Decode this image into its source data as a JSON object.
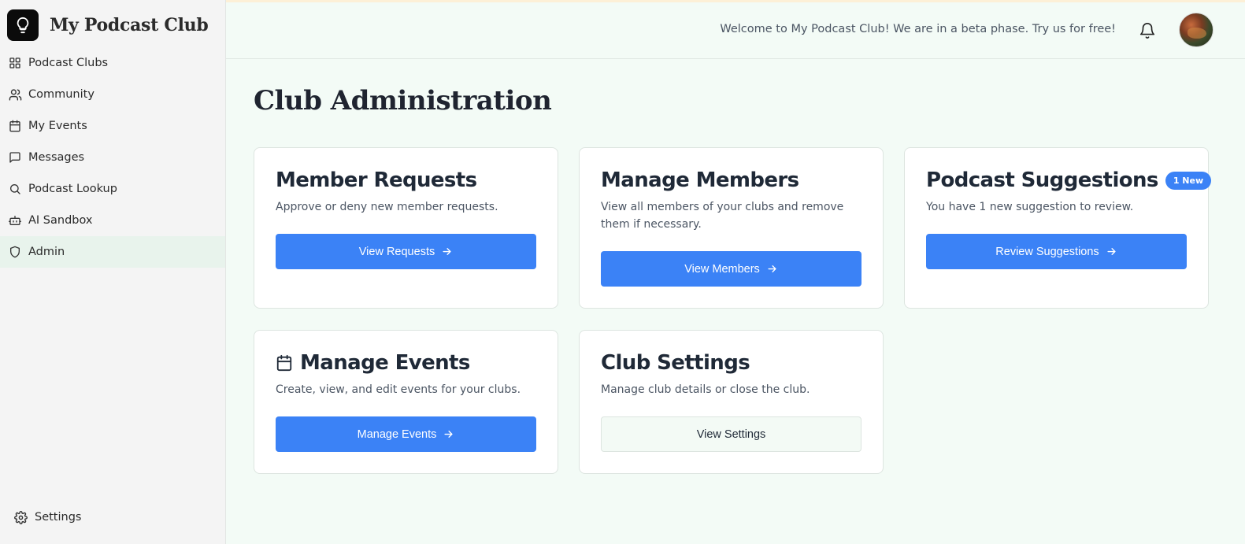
{
  "app": {
    "name": "My Podcast Club"
  },
  "sidebar": {
    "items": [
      {
        "label": "Podcast Clubs",
        "icon": "grid-icon"
      },
      {
        "label": "Community",
        "icon": "users-icon"
      },
      {
        "label": "My Events",
        "icon": "calendar-icon"
      },
      {
        "label": "Messages",
        "icon": "message-icon"
      },
      {
        "label": "Podcast Lookup",
        "icon": "search-icon"
      },
      {
        "label": "AI Sandbox",
        "icon": "bot-icon"
      },
      {
        "label": "Admin",
        "icon": "shield-icon",
        "active": true
      }
    ],
    "settings_label": "Settings"
  },
  "header": {
    "welcome": "Welcome to My Podcast Club! We are in a beta phase. Try us for free!"
  },
  "main": {
    "title": "Club Administration",
    "cards": [
      {
        "title": "Member Requests",
        "description": "Approve or deny new member requests.",
        "button": "View Requests"
      },
      {
        "title": "Manage Members",
        "description": "View all members of your clubs and remove them if necessary.",
        "button": "View Members"
      },
      {
        "title": "Podcast Suggestions",
        "badge": "1 New",
        "description": "You have 1 new suggestion to review.",
        "button": "Review Suggestions"
      },
      {
        "title": "Manage Events",
        "description": "Create, view, and edit events for your clubs.",
        "button": "Manage Events"
      },
      {
        "title": "Club Settings",
        "description": "Manage club details or close the club.",
        "button": "View Settings"
      }
    ]
  },
  "colors": {
    "accent": "#3b82f6",
    "background": "#f3fbf6",
    "sidebar": "#f4f4f4",
    "active_nav": "#e8f3ec"
  }
}
